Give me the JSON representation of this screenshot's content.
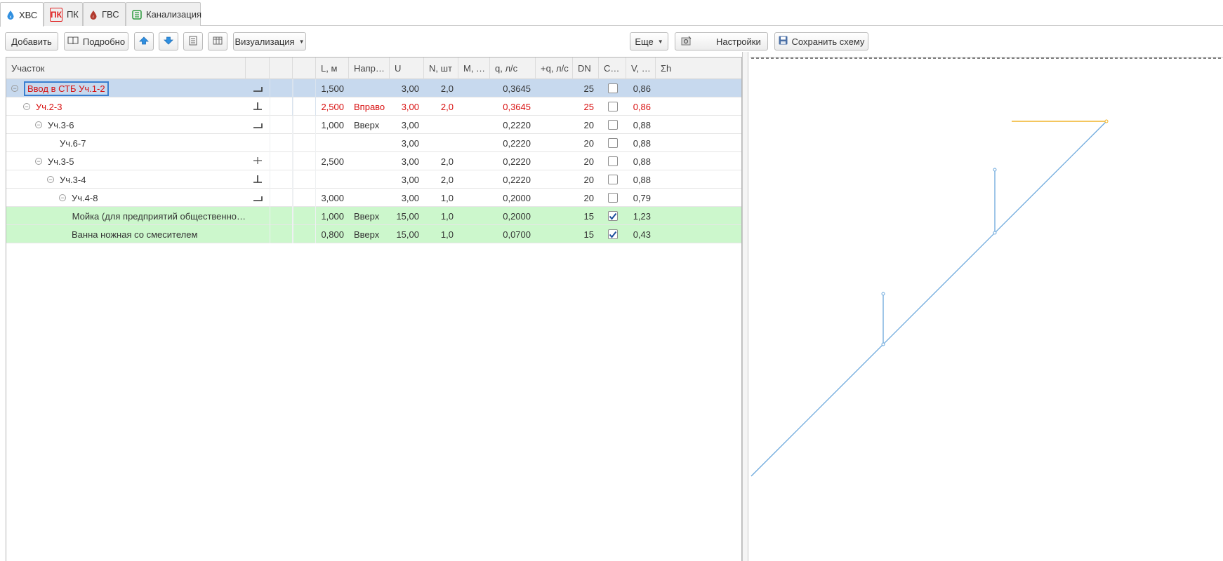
{
  "tabs": [
    {
      "label": "ХВС",
      "icon": "water-drop-icon",
      "active": true
    },
    {
      "label": "ПК",
      "icon": "fire-hydrant-icon",
      "active": false
    },
    {
      "label": "ГВС",
      "icon": "hot-water-drop-icon",
      "active": false
    },
    {
      "label": "Канализация",
      "icon": "sewer-icon",
      "active": false
    }
  ],
  "pk_icon_text": "ПК",
  "toolbar": {
    "add_label": "Добавить",
    "details_label": "Подробно",
    "visualization_label": "Визуализация",
    "more_label": "Еще",
    "settings_label": "Настройки",
    "save_scheme_label": "Сохранить схему"
  },
  "columns": [
    "Участок",
    "",
    "",
    "",
    "L, м",
    "Напр…",
    "U",
    "N, шт",
    "M, …",
    "q, л/с",
    "+q, л/с",
    "DN",
    "С…",
    "V, …",
    "Σh"
  ],
  "rows": [
    {
      "indent": 0,
      "toggle": "⊖",
      "name": "Ввод в СТБ Уч.1-2",
      "fitting": "elbow",
      "L": "1,500",
      "dir": "",
      "U": "3,00",
      "N": "2,0",
      "M": "",
      "q": "0,3645",
      "plus_q": "",
      "DN": "25",
      "checked": false,
      "V": "0,86",
      "style": "sel"
    },
    {
      "indent": 1,
      "toggle": "⊖",
      "name": "Уч.2-3",
      "fitting": "tee",
      "L": "2,500",
      "dir": "Вправо",
      "U": "3,00",
      "N": "2,0",
      "M": "",
      "q": "0,3645",
      "plus_q": "",
      "DN": "25",
      "checked": false,
      "V": "0,86",
      "style": "red"
    },
    {
      "indent": 2,
      "toggle": "⊖",
      "name": "Уч.3-6",
      "fitting": "elbow",
      "L": "1,000",
      "dir": "Вверх",
      "U": "3,00",
      "N": "",
      "M": "",
      "q": "0,2220",
      "plus_q": "",
      "DN": "20",
      "checked": false,
      "V": "0,88",
      "style": "plain"
    },
    {
      "indent": 3,
      "toggle": "",
      "name": "Уч.6-7",
      "fitting": "",
      "L": "",
      "dir": "",
      "U": "3,00",
      "N": "",
      "M": "",
      "q": "0,2220",
      "plus_q": "",
      "DN": "20",
      "checked": false,
      "V": "0,88",
      "style": "plain"
    },
    {
      "indent": 2,
      "toggle": "⊖",
      "name": "Уч.3-5",
      "fitting": "cross",
      "L": "2,500",
      "dir": "",
      "U": "3,00",
      "N": "2,0",
      "M": "",
      "q": "0,2220",
      "plus_q": "",
      "DN": "20",
      "checked": false,
      "V": "0,88",
      "style": "plain"
    },
    {
      "indent": 3,
      "toggle": "⊖",
      "name": "Уч.3-4",
      "fitting": "tee",
      "L": "",
      "dir": "",
      "U": "3,00",
      "N": "2,0",
      "M": "",
      "q": "0,2220",
      "plus_q": "",
      "DN": "20",
      "checked": false,
      "V": "0,88",
      "style": "plain"
    },
    {
      "indent": 4,
      "toggle": "⊖",
      "name": "Уч.4-8",
      "fitting": "elbow",
      "L": "3,000",
      "dir": "",
      "U": "3,00",
      "N": "1,0",
      "M": "",
      "q": "0,2000",
      "plus_q": "",
      "DN": "20",
      "checked": false,
      "V": "0,79",
      "style": "plain"
    },
    {
      "indent": 5,
      "toggle": "",
      "name": "Мойка (для предприятий общественно…",
      "fitting": "",
      "L": "1,000",
      "dir": "Вверх",
      "U": "15,00",
      "N": "1,0",
      "M": "",
      "q": "0,2000",
      "plus_q": "",
      "DN": "15",
      "checked": true,
      "V": "1,23",
      "style": "green"
    },
    {
      "indent": 4,
      "toggle": "",
      "name": "Ванна ножная со смесителем",
      "fitting": "",
      "L": "0,800",
      "dir": "Вверх",
      "U": "15,00",
      "N": "1,0",
      "M": "",
      "q": "0,0700",
      "plus_q": "",
      "DN": "15",
      "checked": true,
      "V": "0,43",
      "style": "green"
    }
  ],
  "colors": {
    "accent_blue": "#3a7fd0",
    "selected_row": "#c7d9ee",
    "fixture_row": "#ccf7cc",
    "error_text": "#d80f0f",
    "pipe_line": "#6ba8dc",
    "highlight_pipe": "#f0b429"
  }
}
